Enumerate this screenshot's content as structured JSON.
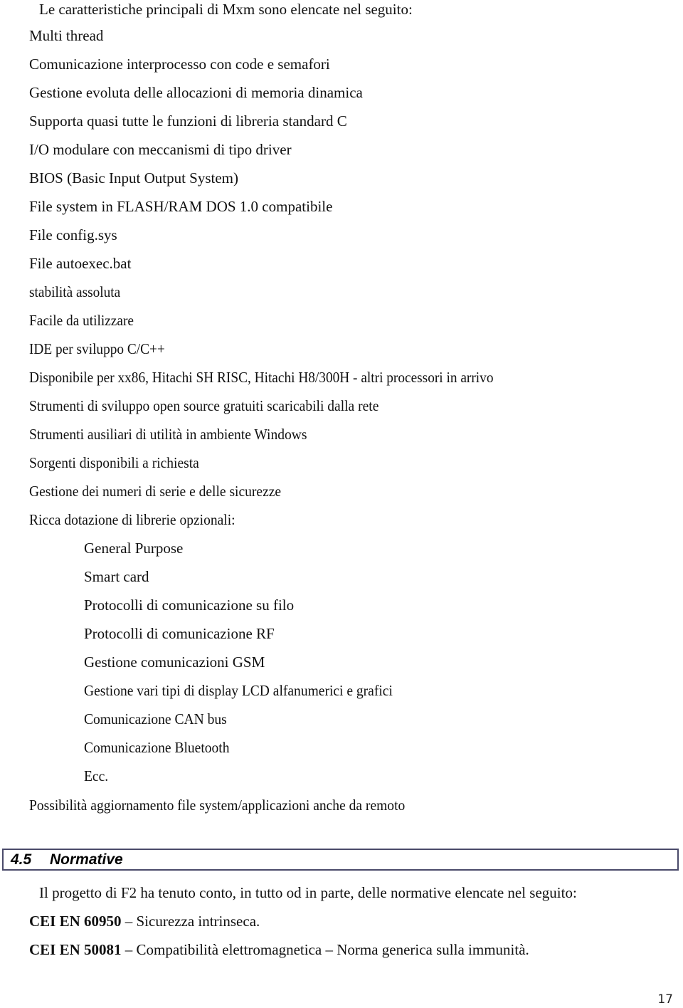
{
  "intro": "Le caratteristiche principali di Mxm sono elencate nel seguito:",
  "features": [
    "Multi thread",
    "Comunicazione interprocesso con code e semafori",
    "Gestione evoluta delle allocazioni di memoria dinamica",
    "Supporta quasi tutte le funzioni di libreria standard C",
    "I/O modulare con meccanismi di tipo driver",
    "BIOS (Basic Input Output System)",
    "File system in FLASH/RAM DOS 1.0 compatibile",
    "File config.sys",
    "File autoexec.bat",
    "stabilità assoluta",
    "Facile da utilizzare",
    "IDE per sviluppo C/C++",
    "Disponibile per xx86, Hitachi SH RISC, Hitachi H8/300H - altri processori in arrivo",
    "Strumenti di sviluppo open source gratuiti scaricabili dalla rete",
    "Strumenti ausiliari di utilità in ambiente Windows",
    "Sorgenti disponibili a richiesta",
    "Gestione dei numeri di serie e delle sicurezze",
    "Ricca dotazione di librerie opzionali:"
  ],
  "libraries": [
    "General Purpose",
    "Smart card",
    "Protocolli di comunicazione su filo",
    "Protocolli di comunicazione RF",
    "Gestione comunicazioni GSM",
    "Gestione vari tipi di display LCD alfanumerici e grafici",
    "Comunicazione CAN bus",
    "Comunicazione Bluetooth",
    "Ecc."
  ],
  "remote_update": "Possibilità aggiornamento file system/applicazioni anche da remoto",
  "section": {
    "number": "4.5",
    "title": "Normative",
    "intro": "Il progetto di F2 ha tenuto conto, in tutto od in parte, delle normative elencate nel seguito:",
    "norms": [
      {
        "code": "CEI EN 60950",
        "description": " – Sicurezza intrinseca."
      },
      {
        "code": "CEI EN 50081",
        "description": " – Compatibilità elettromagnetica – Norma generica sulla immunità."
      }
    ]
  },
  "page_number": "17"
}
